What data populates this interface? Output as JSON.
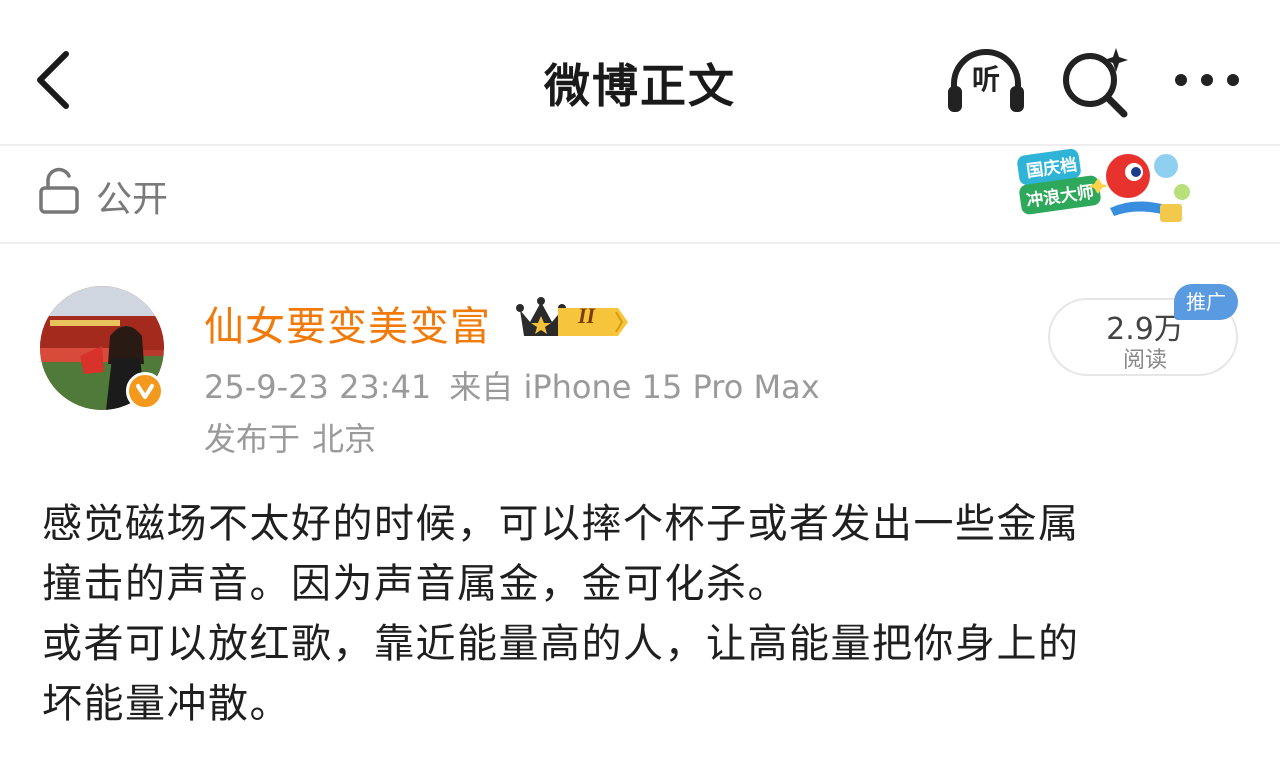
{
  "header": {
    "title": "微博正文",
    "listen_label": "听"
  },
  "visibility": {
    "label": "公开",
    "badge_text": [
      "国庆档",
      "冲浪大师"
    ]
  },
  "author": {
    "name": "仙女要变美变富",
    "vip_level": "II",
    "date": "25-9-23 23:41",
    "source": "来自 iPhone 15 Pro Max",
    "location_prefix": "发布于",
    "location": "北京"
  },
  "stats": {
    "reads_count": "2.9万",
    "reads_label": "阅读",
    "promo_tag": "推广"
  },
  "post": {
    "line1": "感觉磁场不太好的时候，可以摔个杯子或者发出一些金属",
    "line2": "撞击的声音。因为声音属金，金可化杀。",
    "line3": "或者可以放红歌，靠近能量高的人，让高能量把你身上的",
    "line4": "坏能量冲散。"
  },
  "colors": {
    "username": "#f07a0a",
    "verify": "#f39a1e",
    "promo": "#5a9ae0",
    "meta": "#9a9a9a"
  }
}
